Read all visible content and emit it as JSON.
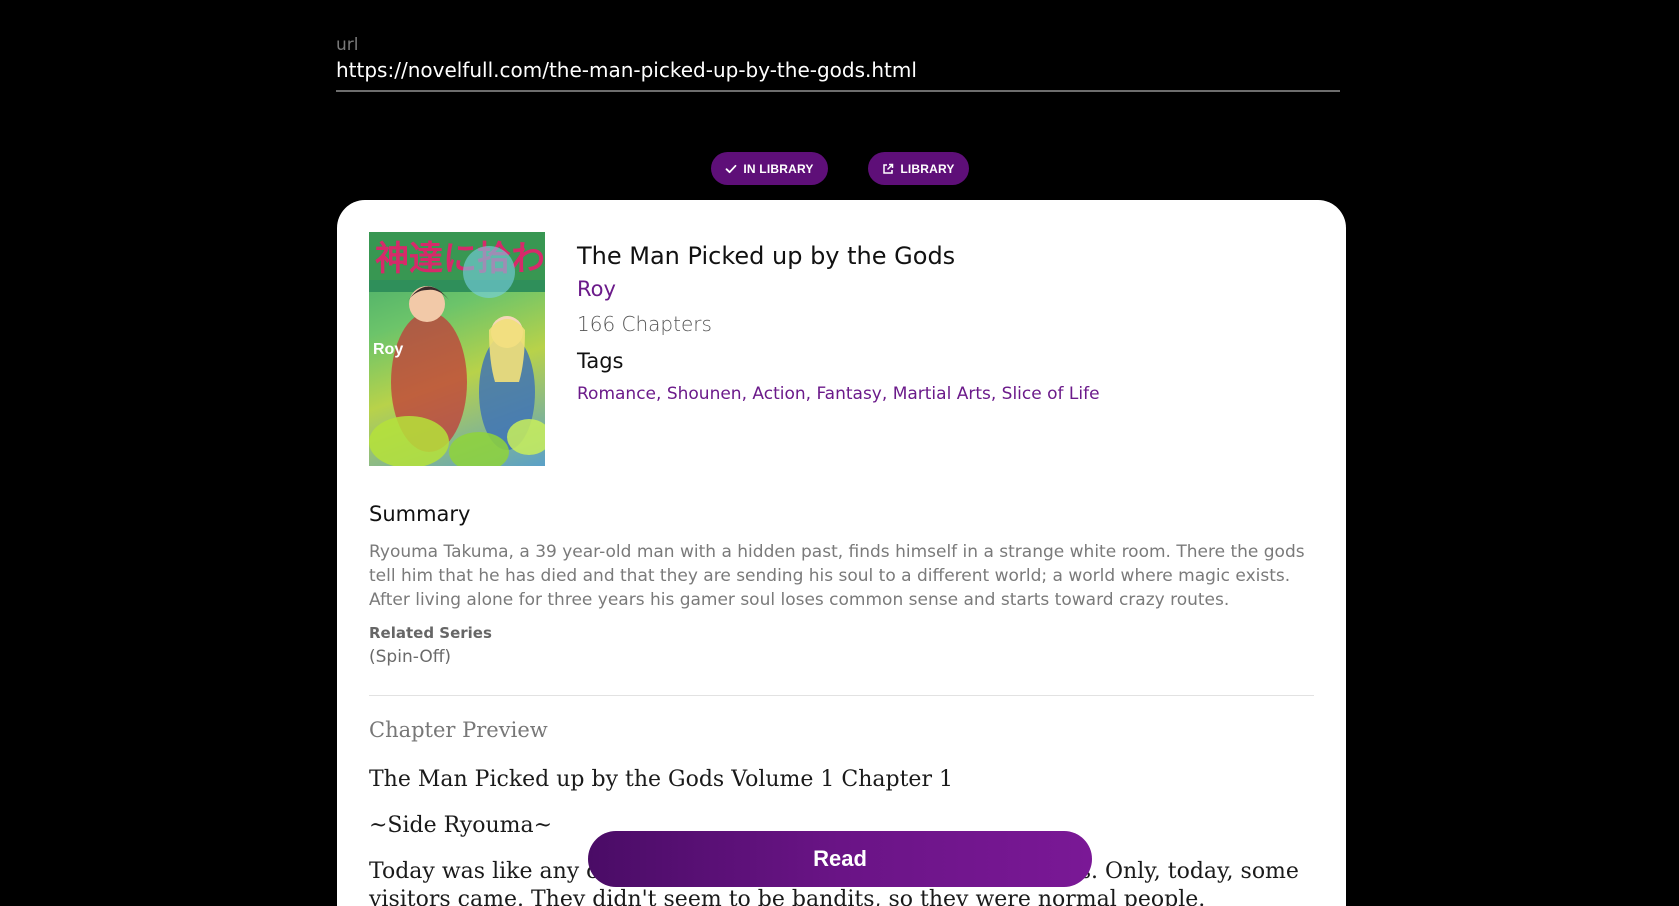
{
  "url_field": {
    "label": "url",
    "value": "https://novelfull.com/the-man-picked-up-by-the-gods.html"
  },
  "actions": {
    "in_library_label": "IN LIBRARY",
    "library_label": "LIBRARY"
  },
  "novel": {
    "cover_text": "Roy",
    "title": "The Man Picked up by the Gods",
    "author": "Roy",
    "chapters": "166 Chapters",
    "tags_heading": "Tags",
    "tags": [
      "Romance",
      "Shounen",
      "Action",
      "Fantasy",
      "Martial Arts",
      "Slice of Life"
    ],
    "summary_heading": "Summary",
    "summary": "Ryouma Takuma, a 39 year-old man with a hidden past, finds himself in a strange white room. There the gods tell him that he has died and that they are sending his soul to a different world; a world where magic exists. After living alone for three years his gamer soul loses common sense and starts toward crazy routes.",
    "related_label": "Related Series",
    "related_value": "(Spin-Off)"
  },
  "preview": {
    "heading": "Chapter Preview",
    "chapter_title": "The Man Picked up by the Gods Volume 1 Chapter 1",
    "scene_marker": "~Side Ryouma~",
    "paragraph": "Today was like any other day, I was gathering food for my slimes. Only, today, some visitors came. They didn't seem to be bandits, so they were normal people."
  },
  "read_button": {
    "label": "Read"
  },
  "colors": {
    "background": "#000000",
    "accent": "#6b1a8a",
    "pill": "#5e0f78",
    "card": "#ffffff"
  }
}
